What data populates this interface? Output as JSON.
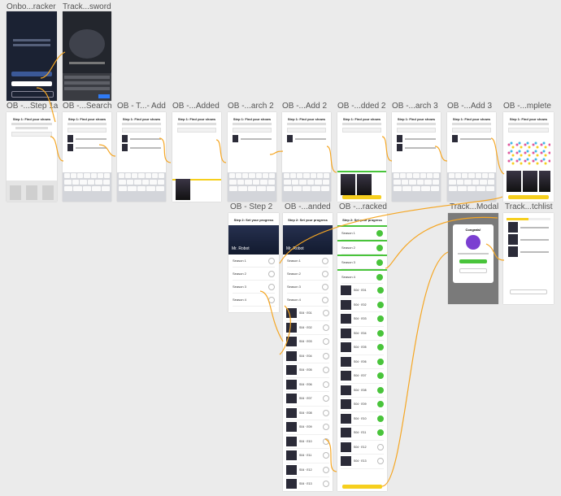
{
  "frames": {
    "onboarding_tracker": "Onbo...racker",
    "track_password": "Track...sword",
    "ob_step1a": "OB -...Step 1a",
    "ob_search": "OB -...Search",
    "ob_t_add": "OB - T...- Add",
    "ob_added": "OB -...Added",
    "ob_search2": "OB -...arch 2",
    "ob_add2": "OB -...Add 2",
    "ob_added2": "OB -...dded 2",
    "ob_search3": "OB -...arch 3",
    "ob_add3": "OB -...Add 3",
    "ob_complete": "OB -...mplete",
    "ob_step2": "OB - Step 2",
    "ob_anded": "OB -...anded",
    "ob_racked": "OB -...racked",
    "track_modal": "Track...Modal",
    "track_watchlist": "Track...tchlist"
  },
  "screens": {
    "step1_title": "Step 1: Find your shows",
    "step2_title": "Step 2: Set your progress",
    "show_name": "Mr. Robot",
    "continue_label": "CONTINUE",
    "done_label": "DONE",
    "congrats": "Congrats!",
    "seasons": [
      "Season 1",
      "Season 2",
      "Season 3",
      "Season 4"
    ],
    "episodes": [
      "S04 · E01",
      "S04 · E02",
      "S04 · E03",
      "S04 · E04",
      "S04 · E05",
      "S04 · E06",
      "S04 · E07",
      "S04 · E08",
      "S04 · E09",
      "S04 · E10",
      "S04 · E11",
      "S04 · E12",
      "S04 · E13"
    ]
  },
  "colors": {
    "connector": "#f5a623",
    "accent": "#f6cf1e",
    "check": "#49c43b"
  }
}
